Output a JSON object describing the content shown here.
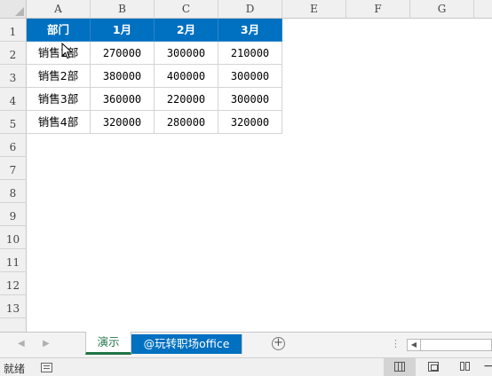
{
  "sheet": {
    "column_headers": [
      "A",
      "B",
      "C",
      "D",
      "E",
      "F",
      "G"
    ],
    "row_headers": [
      "1",
      "2",
      "3",
      "4",
      "5",
      "6",
      "7",
      "8",
      "9",
      "10",
      "11",
      "12",
      "13"
    ],
    "table_header": [
      "部门",
      "1月",
      "2月",
      "3月"
    ],
    "table_rows": [
      [
        "销售1部",
        "270000",
        "300000",
        "210000"
      ],
      [
        "销售2部",
        "380000",
        "400000",
        "300000"
      ],
      [
        "销售3部",
        "360000",
        "220000",
        "300000"
      ],
      [
        "销售4部",
        "320000",
        "280000",
        "320000"
      ]
    ],
    "header_fill": "#0070c0"
  },
  "tabs": {
    "prev_label": "◀",
    "next_label": "▶",
    "active_tab": "演示",
    "second_tab": "@玩转职场office",
    "add_label": "+",
    "more_label": "⋮",
    "scroll_left_label": "◀"
  },
  "status": {
    "ready_text": "就绪",
    "zoom_minus": "−"
  },
  "icons": {
    "macro": "macro-record-icon",
    "normal_view": "normal-view-icon",
    "page_layout": "page-layout-icon",
    "page_break": "page-break-icon",
    "cursor": "mouse-cursor-icon"
  }
}
